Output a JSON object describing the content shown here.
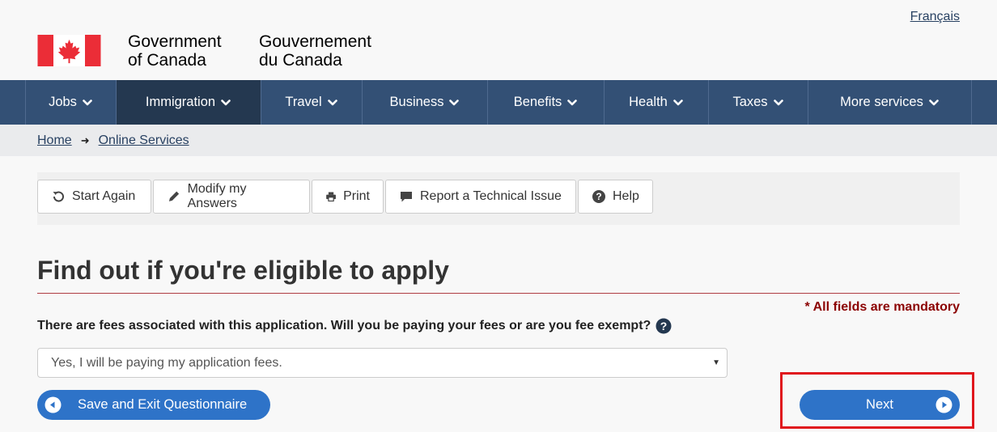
{
  "header": {
    "lang_toggle": "Français",
    "signature_en_line1": "Government",
    "signature_en_line2": "of Canada",
    "signature_fr_line1": "Gouvernement",
    "signature_fr_line2": "du Canada"
  },
  "nav": {
    "items": [
      {
        "label": "Jobs"
      },
      {
        "label": "Immigration"
      },
      {
        "label": "Travel"
      },
      {
        "label": "Business"
      },
      {
        "label": "Benefits"
      },
      {
        "label": "Health"
      },
      {
        "label": "Taxes"
      },
      {
        "label": "More services"
      }
    ],
    "active_item": "Immigration"
  },
  "breadcrumb": {
    "items": [
      {
        "label": "Home"
      },
      {
        "label": "Online Services"
      }
    ]
  },
  "toolbar": {
    "start_again": "Start Again",
    "modify_answers": "Modify my Answers",
    "print": "Print",
    "report_issue": "Report a Technical Issue",
    "help": "Help"
  },
  "main": {
    "title": "Find out if you're eligible to apply",
    "mandatory_note": "* All fields are mandatory",
    "question": "There are fees associated with this application. Will you be paying your fees or are you fee exempt?",
    "selected_option": "Yes, I will be paying my application fees.",
    "save_exit_label": "Save and Exit Questionnaire",
    "next_label": "Next"
  },
  "colors": {
    "nav_background": "#335075",
    "nav_active": "#243850",
    "button_blue": "#2e73c8",
    "title_rule": "#af3c43",
    "mandatory": "#8b0000",
    "highlight": "#e0161d",
    "flag_red": "#eb2d37"
  }
}
